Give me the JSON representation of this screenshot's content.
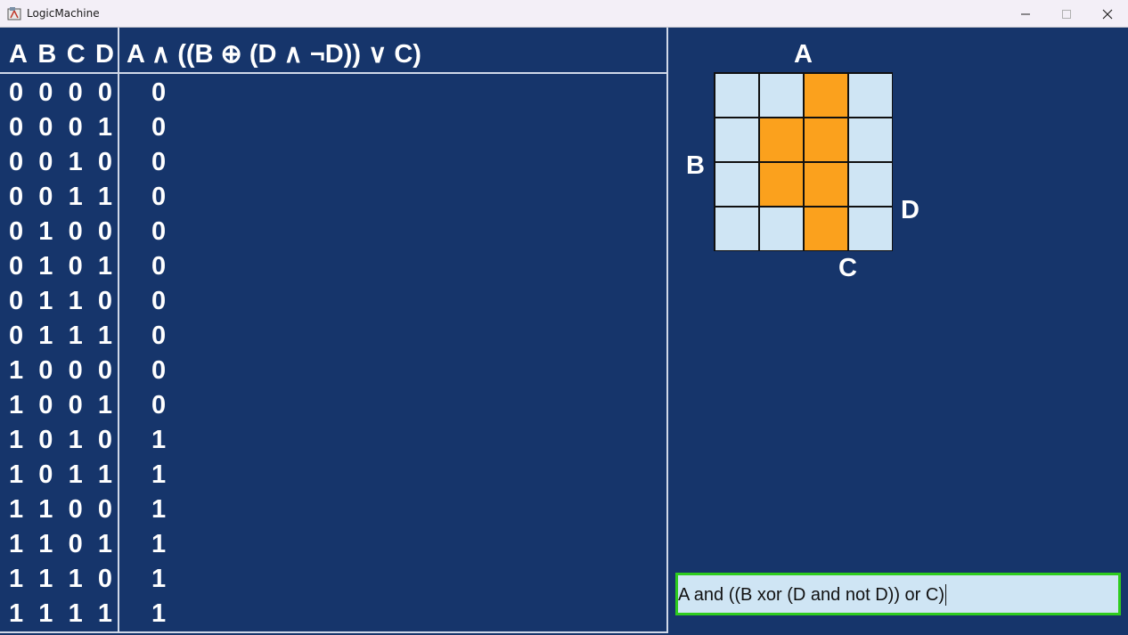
{
  "window": {
    "title": "LogicMachine",
    "buttons": {
      "minimize": "minimize-icon",
      "maximize": "maximize-icon",
      "close": "close-icon"
    }
  },
  "truth_table": {
    "variables": [
      "A",
      "B",
      "C",
      "D"
    ],
    "expression_header": "A ∧ ((B ⊕ (D ∧ ¬D)) ∨ C)",
    "rows": [
      {
        "bits": [
          "0",
          "0",
          "0",
          "0"
        ],
        "out": "0"
      },
      {
        "bits": [
          "0",
          "0",
          "0",
          "1"
        ],
        "out": "0"
      },
      {
        "bits": [
          "0",
          "0",
          "1",
          "0"
        ],
        "out": "0"
      },
      {
        "bits": [
          "0",
          "0",
          "1",
          "1"
        ],
        "out": "0"
      },
      {
        "bits": [
          "0",
          "1",
          "0",
          "0"
        ],
        "out": "0"
      },
      {
        "bits": [
          "0",
          "1",
          "0",
          "1"
        ],
        "out": "0"
      },
      {
        "bits": [
          "0",
          "1",
          "1",
          "0"
        ],
        "out": "0"
      },
      {
        "bits": [
          "0",
          "1",
          "1",
          "1"
        ],
        "out": "0"
      },
      {
        "bits": [
          "1",
          "0",
          "0",
          "0"
        ],
        "out": "0"
      },
      {
        "bits": [
          "1",
          "0",
          "0",
          "1"
        ],
        "out": "0"
      },
      {
        "bits": [
          "1",
          "0",
          "1",
          "0"
        ],
        "out": "1"
      },
      {
        "bits": [
          "1",
          "0",
          "1",
          "1"
        ],
        "out": "1"
      },
      {
        "bits": [
          "1",
          "1",
          "0",
          "0"
        ],
        "out": "1"
      },
      {
        "bits": [
          "1",
          "1",
          "0",
          "1"
        ],
        "out": "1"
      },
      {
        "bits": [
          "1",
          "1",
          "1",
          "0"
        ],
        "out": "1"
      },
      {
        "bits": [
          "1",
          "1",
          "1",
          "1"
        ],
        "out": "1"
      }
    ]
  },
  "karnaugh_map": {
    "labels": {
      "top": "A",
      "left": "B",
      "right": "D",
      "bottom": "C"
    },
    "cells": [
      [
        0,
        0,
        1,
        0
      ],
      [
        0,
        1,
        1,
        0
      ],
      [
        0,
        1,
        1,
        0
      ],
      [
        0,
        0,
        1,
        0
      ]
    ],
    "colors": {
      "on": "#fba11d",
      "off": "#cfe5f4"
    }
  },
  "expression_input": {
    "value": "A and ((B xor (D and not D)) or C)"
  },
  "colors": {
    "background": "#16356b",
    "input_border": "#2ecc1e"
  }
}
